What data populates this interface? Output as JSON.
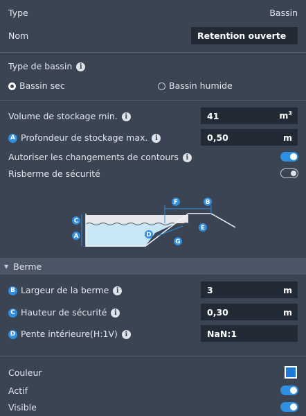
{
  "header": {
    "type_label": "Type",
    "type_value": "Bassin",
    "name_label": "Nom",
    "name_value": "Retention ouverte"
  },
  "basin_type": {
    "label": "Type de bassin",
    "options": [
      {
        "label": "Bassin sec",
        "selected": true
      },
      {
        "label": "Bassin humide",
        "selected": false
      }
    ]
  },
  "fields": {
    "volume": {
      "label": "Volume de stockage min.",
      "value": "41",
      "unit_base": "m",
      "unit_sup": "3"
    },
    "depth": {
      "badge": "A",
      "label": "Profondeur de stockage max.",
      "value": "0,50",
      "unit": "m"
    },
    "contour_changes": {
      "label": "Autoriser les changements de contours",
      "on": true
    },
    "safety_berm": {
      "label": "Risberme de sécurité",
      "on": false
    }
  },
  "diagram": {
    "labels": [
      "A",
      "B",
      "C",
      "D",
      "E",
      "F",
      "G"
    ]
  },
  "berm_section": {
    "title": "Berme",
    "width": {
      "badge": "B",
      "label": "Largeur de la berme",
      "value": "3",
      "unit": "m"
    },
    "safety_height": {
      "badge": "C",
      "label": "Hauteur de sécurité",
      "value": "0,30",
      "unit": "m"
    },
    "slope": {
      "badge": "D",
      "label": "Pente intérieure(H:1V)",
      "value": "NaN:1"
    }
  },
  "appearance": {
    "color_label": "Couleur",
    "color_value": "#1e7ad9",
    "active_label": "Actif",
    "active_on": true,
    "visible_label": "Visible",
    "visible_on": true
  },
  "colors": {
    "background": "#3b4453",
    "accent": "#2f8fe0",
    "field": "#222a35"
  }
}
